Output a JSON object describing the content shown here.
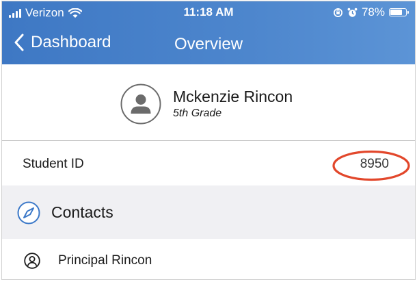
{
  "status_bar": {
    "carrier": "Verizon",
    "time": "11:18 AM",
    "battery_percent": "78%",
    "battery_level": 0.78
  },
  "nav": {
    "back_label": "Dashboard",
    "title": "Overview"
  },
  "student": {
    "name": "Mckenzie Rincon",
    "grade": "5th Grade"
  },
  "student_id": {
    "label": "Student ID",
    "value": "8950"
  },
  "contacts": {
    "title": "Contacts",
    "items": [
      {
        "name": "Principal Rincon"
      }
    ]
  },
  "colors": {
    "header_blue": "#4a82cb",
    "section_gray": "#f0f0f3",
    "compass_blue": "#3b78c8",
    "highlight_red": "#e2472b"
  },
  "icons": {
    "back": "chevron-left-icon",
    "avatar": "person-circle-icon",
    "section": "compass-icon",
    "contact": "person-outline-icon"
  }
}
